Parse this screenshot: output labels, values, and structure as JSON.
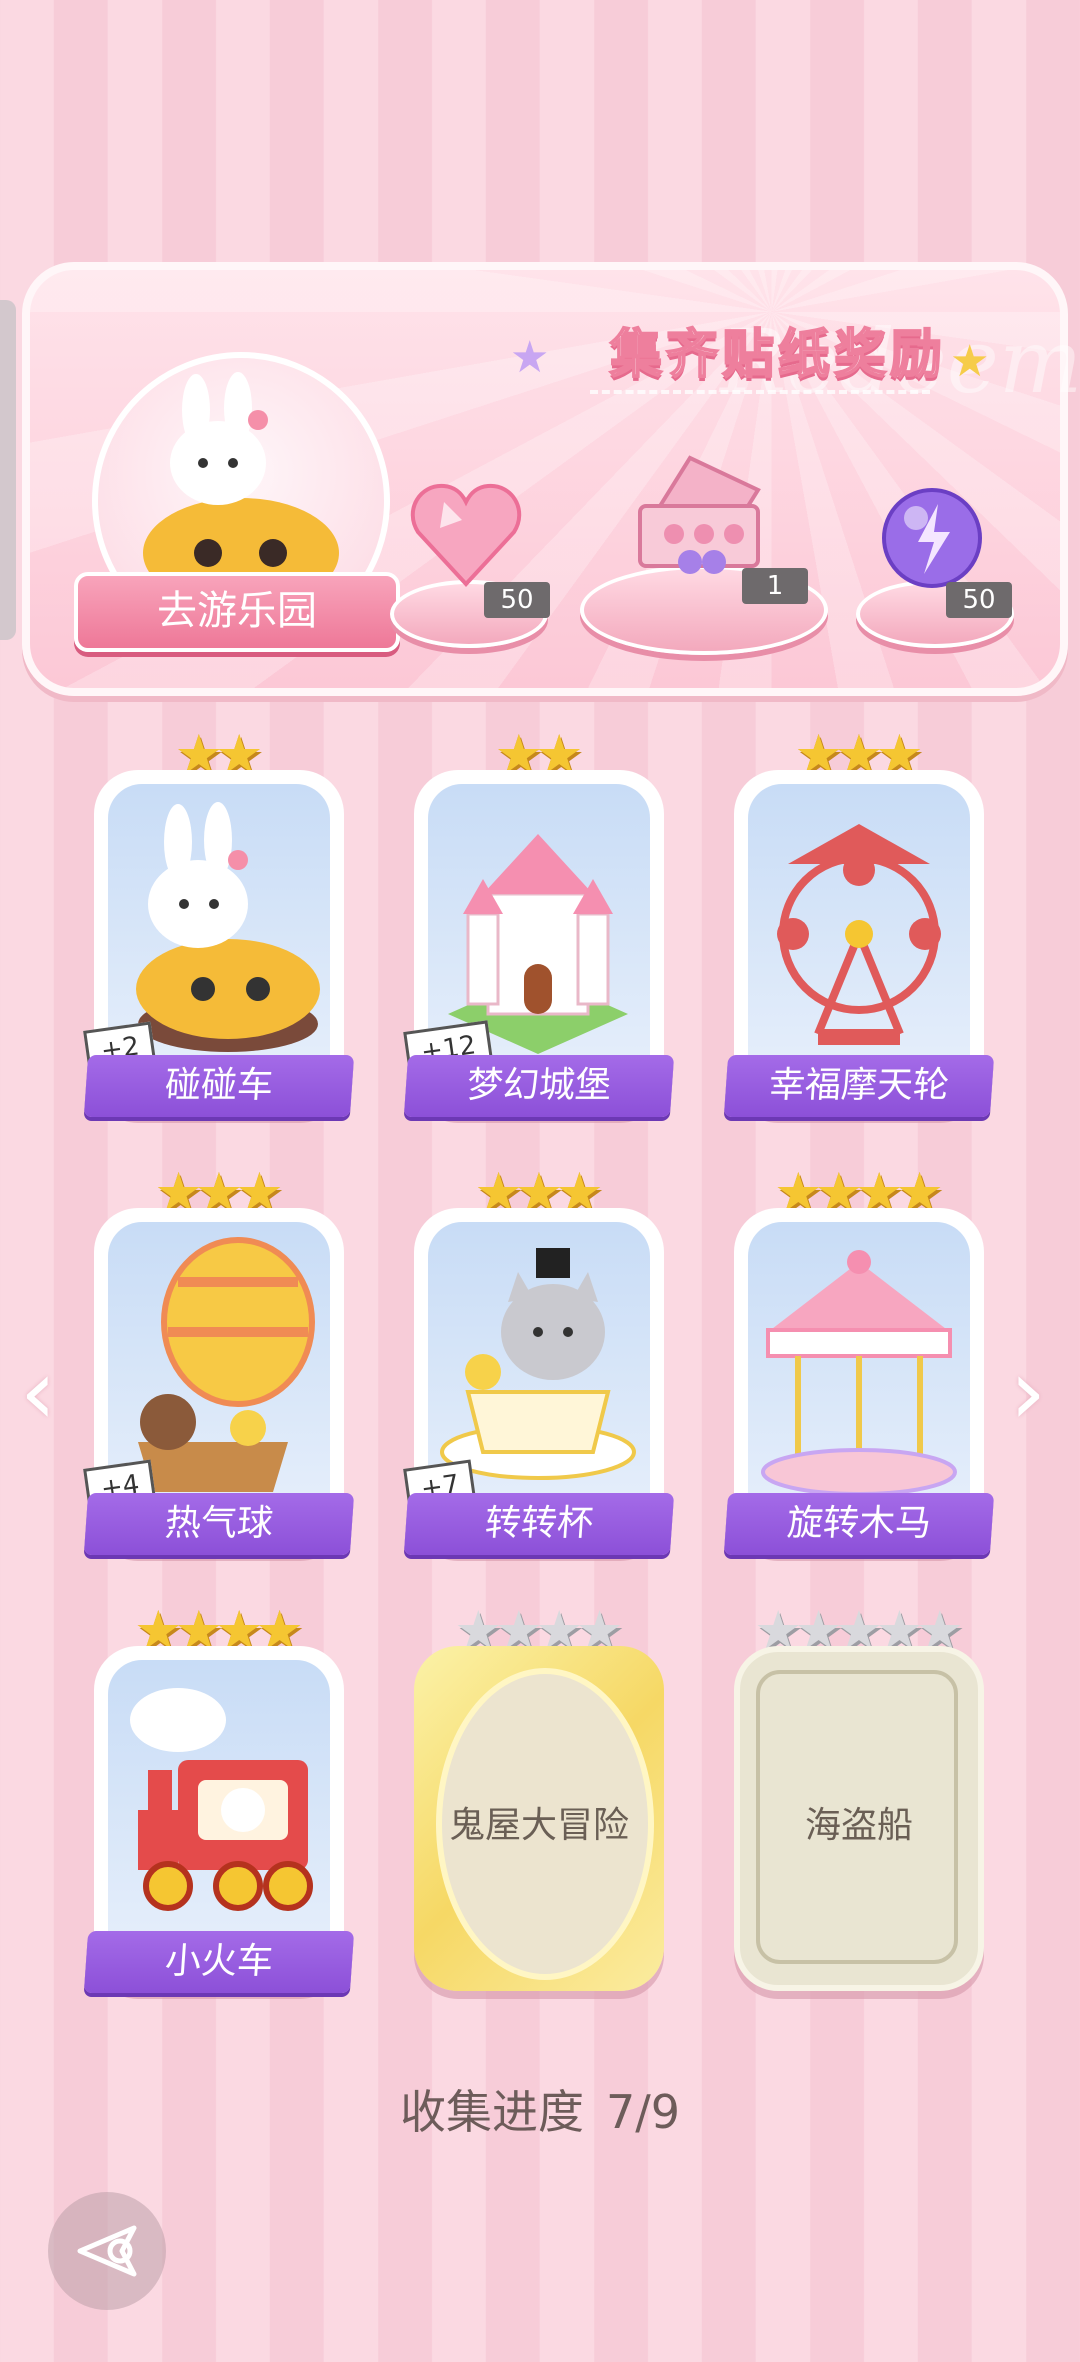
{
  "reward_panel": {
    "title": "集齐贴纸奖励",
    "watermark": "Redeem",
    "go_button_label": "去游乐园",
    "rewards": [
      {
        "icon": "pink-heart-gem-icon",
        "count": "50"
      },
      {
        "icon": "gift-box-icon",
        "count": "1"
      },
      {
        "icon": "purple-lightning-orb-icon",
        "count": "50"
      }
    ]
  },
  "cards": [
    {
      "name": "碰碰车",
      "stars": 2,
      "max_stars": 2,
      "bonus": "+2",
      "locked": false
    },
    {
      "name": "梦幻城堡",
      "stars": 2,
      "max_stars": 2,
      "bonus": "+12",
      "locked": false
    },
    {
      "name": "幸福摩天轮",
      "stars": 3,
      "max_stars": 3,
      "bonus": "",
      "locked": false
    },
    {
      "name": "热气球",
      "stars": 3,
      "max_stars": 3,
      "bonus": "+4",
      "locked": false
    },
    {
      "name": "转转杯",
      "stars": 3,
      "max_stars": 3,
      "bonus": "+7",
      "locked": false
    },
    {
      "name": "旋转木马",
      "stars": 4,
      "max_stars": 4,
      "bonus": "",
      "locked": false
    },
    {
      "name": "小火车",
      "stars": 4,
      "max_stars": 4,
      "bonus": "",
      "locked": false
    },
    {
      "name": "鬼屋大冒险",
      "stars": 0,
      "max_stars": 4,
      "bonus": "",
      "locked": true
    },
    {
      "name": "海盗船",
      "stars": 0,
      "max_stars": 5,
      "bonus": "",
      "locked": true
    }
  ],
  "progress": {
    "label": "收集进度",
    "value": "7/9",
    "fraction": 0.778
  },
  "colors": {
    "banner_purple": "#9b5fe3",
    "star_gold": "#f5c632",
    "panel_pink": "#fcc8d6"
  }
}
